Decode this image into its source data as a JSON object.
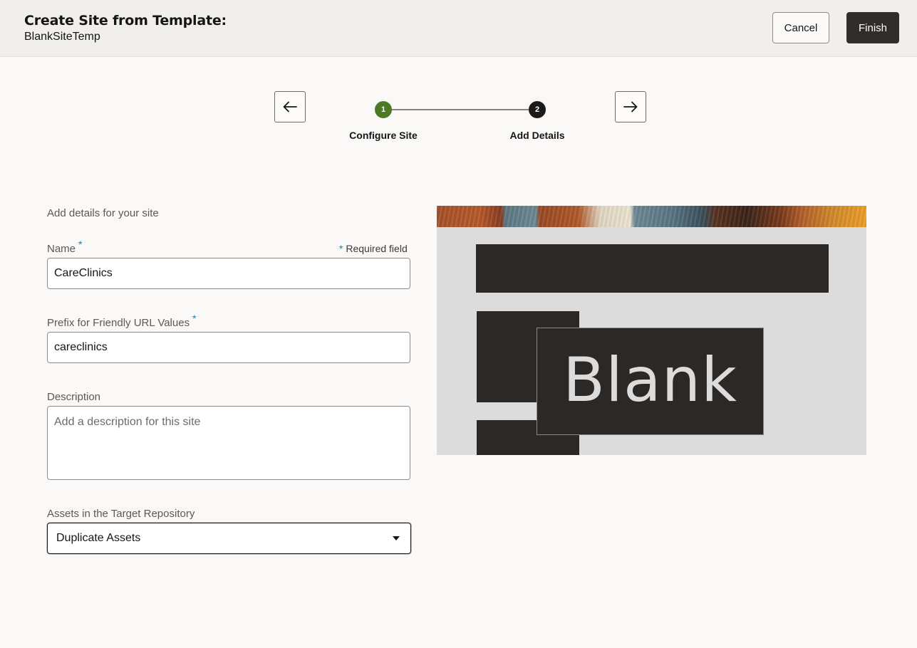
{
  "header": {
    "title": "Create Site from Template:",
    "subtitle": "BlankSiteTemp",
    "cancel_label": "Cancel",
    "finish_label": "Finish"
  },
  "train": {
    "steps": [
      {
        "number": "1",
        "label": "Configure Site",
        "state": "completed"
      },
      {
        "number": "2",
        "label": "Add Details",
        "state": "current"
      }
    ]
  },
  "form": {
    "heading": "Add details for your site",
    "required_star": "*",
    "required_note": "Required field",
    "name": {
      "label": "Name",
      "value": "CareClinics"
    },
    "prefix": {
      "label": "Prefix for Friendly URL Values",
      "value": "careclinics"
    },
    "description": {
      "label": "Description",
      "placeholder": "Add a description for this site"
    },
    "assets": {
      "label": "Assets in the Target Repository",
      "value": "Duplicate Assets"
    }
  },
  "preview": {
    "template_text": "Blank"
  },
  "colors": {
    "accent_green": "#4c7a23",
    "dark": "#312d2a",
    "required_blue": "#227e9e"
  }
}
